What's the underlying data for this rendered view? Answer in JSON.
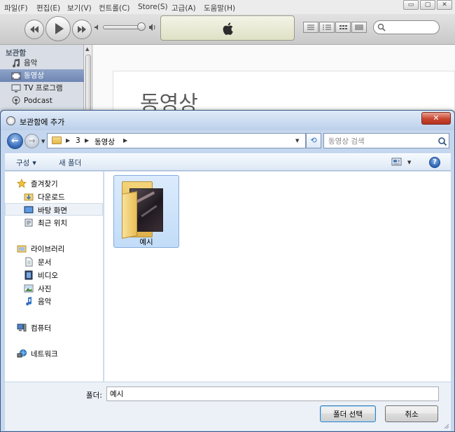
{
  "itunes": {
    "menu": [
      "파일(F)",
      "편집(E)",
      "보기(V)",
      "컨트롤(C)",
      "Store(S)",
      "고급(A)",
      "도움말(H)"
    ],
    "window_buttons": {
      "minimize": "▭",
      "restore": "▢",
      "close": "✕"
    },
    "sidebar": {
      "heading": "보관함",
      "items": [
        {
          "label": "음악",
          "icon": "music-note-icon",
          "selected": false
        },
        {
          "label": "동영상",
          "icon": "movie-icon",
          "selected": true
        },
        {
          "label": "TV 프로그램",
          "icon": "tv-icon",
          "selected": false
        },
        {
          "label": "Podcast",
          "icon": "podcast-icon",
          "selected": false
        }
      ]
    },
    "content_title": "동영상"
  },
  "dialog": {
    "title": "보관함에 추가",
    "close_label": "✕",
    "breadcrumb": [
      "3",
      "동영상"
    ],
    "search_placeholder": "동영상 검색",
    "toolbar": {
      "organize": "구성",
      "new_folder": "새 폴더"
    },
    "nav_pane": {
      "favorites": {
        "label": "즐겨찾기",
        "items": [
          "다운로드",
          "바탕 화면",
          "최근 위치"
        ]
      },
      "libraries": {
        "label": "라이브러리",
        "items": [
          "문서",
          "비디오",
          "사진",
          "음악"
        ]
      },
      "computer": "컴퓨터",
      "network": "네트워크"
    },
    "files": [
      {
        "name": "예시",
        "type": "folder",
        "selected": true
      }
    ],
    "folder_label": "폴더:",
    "folder_value": "예시",
    "select_button": "폴더 선택",
    "cancel_button": "취소"
  },
  "colors": {
    "selection_blue": "#c2dcf8",
    "sidebar_selected": "#6e86b3",
    "dialog_frame": "#c5d7ee",
    "close_red": "#c8452f"
  }
}
